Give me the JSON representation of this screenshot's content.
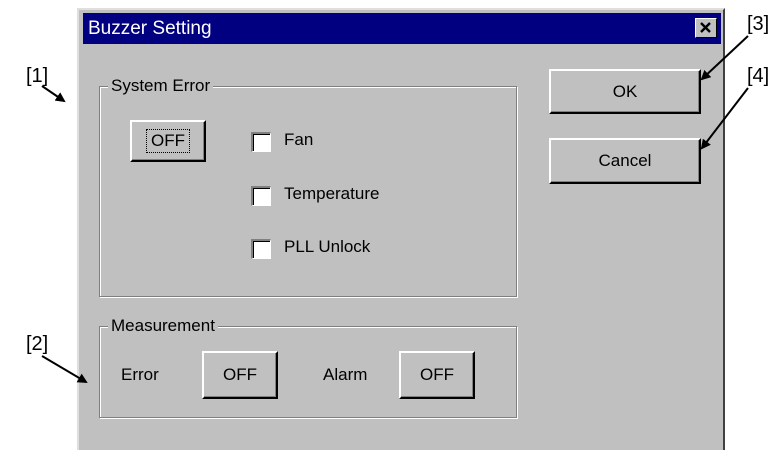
{
  "callouts": [
    "[1]",
    "[2]",
    "[3]",
    "[4]"
  ],
  "dialog": {
    "title": "Buzzer Setting",
    "close_glyph": "✕"
  },
  "system_error": {
    "group_label": "System Error",
    "toggle_label": "OFF",
    "checkboxes": [
      {
        "label": "Fan",
        "checked": false
      },
      {
        "label": "Temperature",
        "checked": false
      },
      {
        "label": "PLL Unlock",
        "checked": false
      }
    ]
  },
  "measurement": {
    "group_label": "Measurement",
    "error_label": "Error",
    "error_toggle": "OFF",
    "alarm_label": "Alarm",
    "alarm_toggle": "OFF"
  },
  "buttons": {
    "ok": "OK",
    "cancel": "Cancel"
  }
}
